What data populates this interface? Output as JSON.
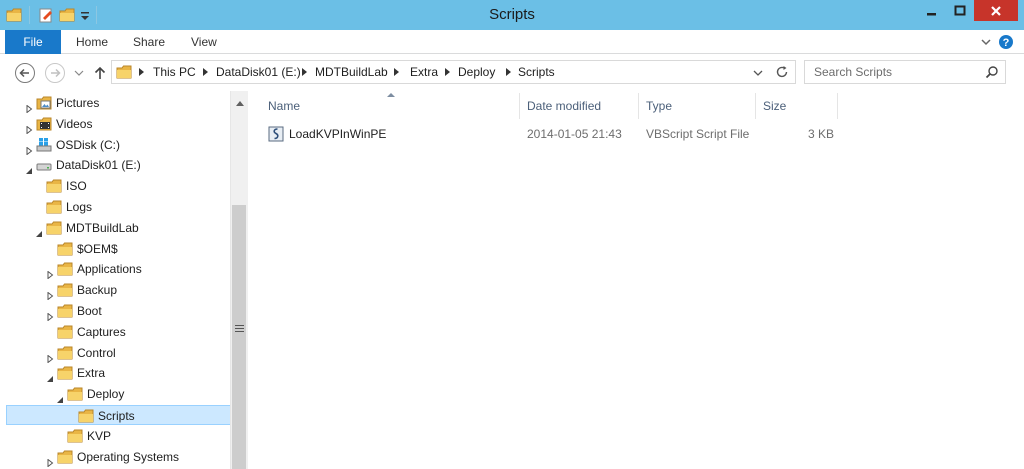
{
  "window": {
    "title": "Scripts"
  },
  "ribbon": {
    "tabs": [
      "File",
      "Home",
      "Share",
      "View"
    ]
  },
  "address": {
    "crumbs": [
      "This PC",
      "DataDisk01 (E:)",
      "MDTBuildLab",
      "Extra",
      "Deploy",
      "Scripts"
    ]
  },
  "search": {
    "placeholder": "Search Scripts"
  },
  "tree": {
    "items": [
      {
        "label": "Pictures",
        "level": 1,
        "expander": "collapsed",
        "icon": "pictures-folder-icon"
      },
      {
        "label": "Videos",
        "level": 1,
        "expander": "collapsed",
        "icon": "videos-folder-icon"
      },
      {
        "label": "OSDisk (C:)",
        "level": 1,
        "expander": "collapsed",
        "icon": "windows-drive-icon"
      },
      {
        "label": "DataDisk01 (E:)",
        "level": 1,
        "expander": "expanded",
        "icon": "drive-icon"
      },
      {
        "label": "ISO",
        "level": 2,
        "expander": "none",
        "icon": "folder-icon"
      },
      {
        "label": "Logs",
        "level": 2,
        "expander": "none",
        "icon": "folder-icon"
      },
      {
        "label": "MDTBuildLab",
        "level": 2,
        "expander": "expanded",
        "icon": "folder-icon"
      },
      {
        "label": "$OEM$",
        "level": 3,
        "expander": "none",
        "icon": "folder-icon"
      },
      {
        "label": "Applications",
        "level": 3,
        "expander": "collapsed",
        "icon": "folder-icon"
      },
      {
        "label": "Backup",
        "level": 3,
        "expander": "collapsed",
        "icon": "folder-icon"
      },
      {
        "label": "Boot",
        "level": 3,
        "expander": "collapsed",
        "icon": "folder-icon"
      },
      {
        "label": "Captures",
        "level": 3,
        "expander": "none",
        "icon": "folder-icon"
      },
      {
        "label": "Control",
        "level": 3,
        "expander": "collapsed",
        "icon": "folder-icon"
      },
      {
        "label": "Extra",
        "level": 3,
        "expander": "expanded",
        "icon": "folder-icon"
      },
      {
        "label": "Deploy",
        "level": 4,
        "expander": "expanded",
        "icon": "folder-icon"
      },
      {
        "label": "Scripts",
        "level": 5,
        "expander": "none",
        "icon": "folder-icon",
        "selected": true
      },
      {
        "label": "KVP",
        "level": 4,
        "expander": "none",
        "icon": "folder-icon"
      },
      {
        "label": "Operating Systems",
        "level": 3,
        "expander": "collapsed",
        "icon": "folder-icon"
      }
    ]
  },
  "files": {
    "columns": [
      "Name",
      "Date modified",
      "Type",
      "Size"
    ],
    "rows": [
      {
        "name": "LoadKVPInWinPE",
        "date": "2014-01-05 21:43",
        "type": "VBScript Script File",
        "size": "3 KB",
        "icon": "vbscript-file-icon"
      }
    ]
  },
  "colors": {
    "titlebar": "#6bbfe6",
    "file_tab": "#1979ca",
    "close_button": "#c7342a",
    "selection": "#cce8ff"
  }
}
